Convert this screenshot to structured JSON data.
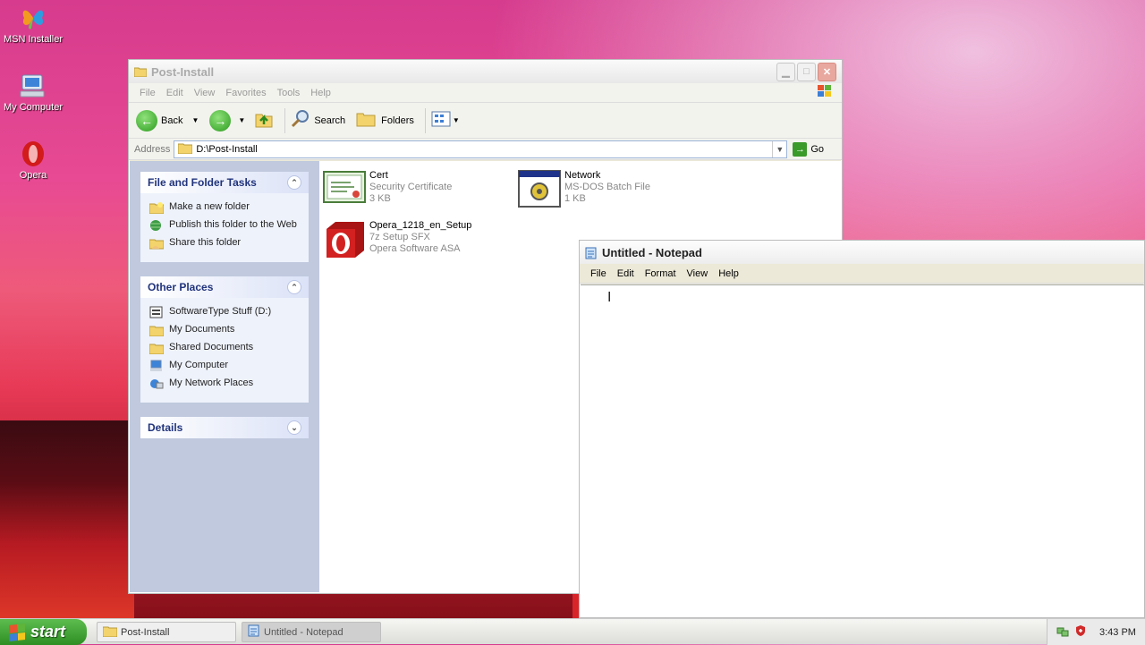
{
  "desktop": {
    "icons": [
      {
        "label": "MSN Installer",
        "icon": "msn-butterfly-icon"
      },
      {
        "label": "My Computer",
        "icon": "computer-icon"
      },
      {
        "label": "Opera",
        "icon": "opera-icon"
      }
    ]
  },
  "explorer": {
    "title": "Post-Install",
    "menu": [
      "File",
      "Edit",
      "View",
      "Favorites",
      "Tools",
      "Help"
    ],
    "toolbar": {
      "back": "Back",
      "search": "Search",
      "folders": "Folders"
    },
    "address": {
      "label": "Address",
      "value": "D:\\Post-Install",
      "go": "Go"
    },
    "tasks_panel": {
      "title": "File and Folder Tasks",
      "items": [
        "Make a new folder",
        "Publish this folder to the Web",
        "Share this folder"
      ]
    },
    "other_places": {
      "title": "Other Places",
      "items": [
        "SoftwareType Stuff (D:)",
        "My Documents",
        "Shared Documents",
        "My Computer",
        "My Network Places"
      ]
    },
    "details": {
      "title": "Details"
    },
    "files": [
      {
        "name": "Cert",
        "type": "Security Certificate",
        "size": "3 KB",
        "icon": "certificate-icon"
      },
      {
        "name": "Network",
        "type": "MS-DOS Batch File",
        "size": "1 KB",
        "icon": "batch-file-icon"
      },
      {
        "name": "Opera_1218_en_Setup",
        "type": "7z Setup SFX",
        "size": "Opera Software ASA",
        "icon": "opera-setup-icon"
      }
    ]
  },
  "notepad": {
    "title": "Untitled - Notepad",
    "menu": [
      "File",
      "Edit",
      "Format",
      "View",
      "Help"
    ],
    "cursor": "I"
  },
  "taskbar": {
    "start": "start",
    "tasks": [
      {
        "label": "Post-Install"
      },
      {
        "label": "Untitled - Notepad"
      }
    ],
    "clock": "3:43 PM"
  }
}
